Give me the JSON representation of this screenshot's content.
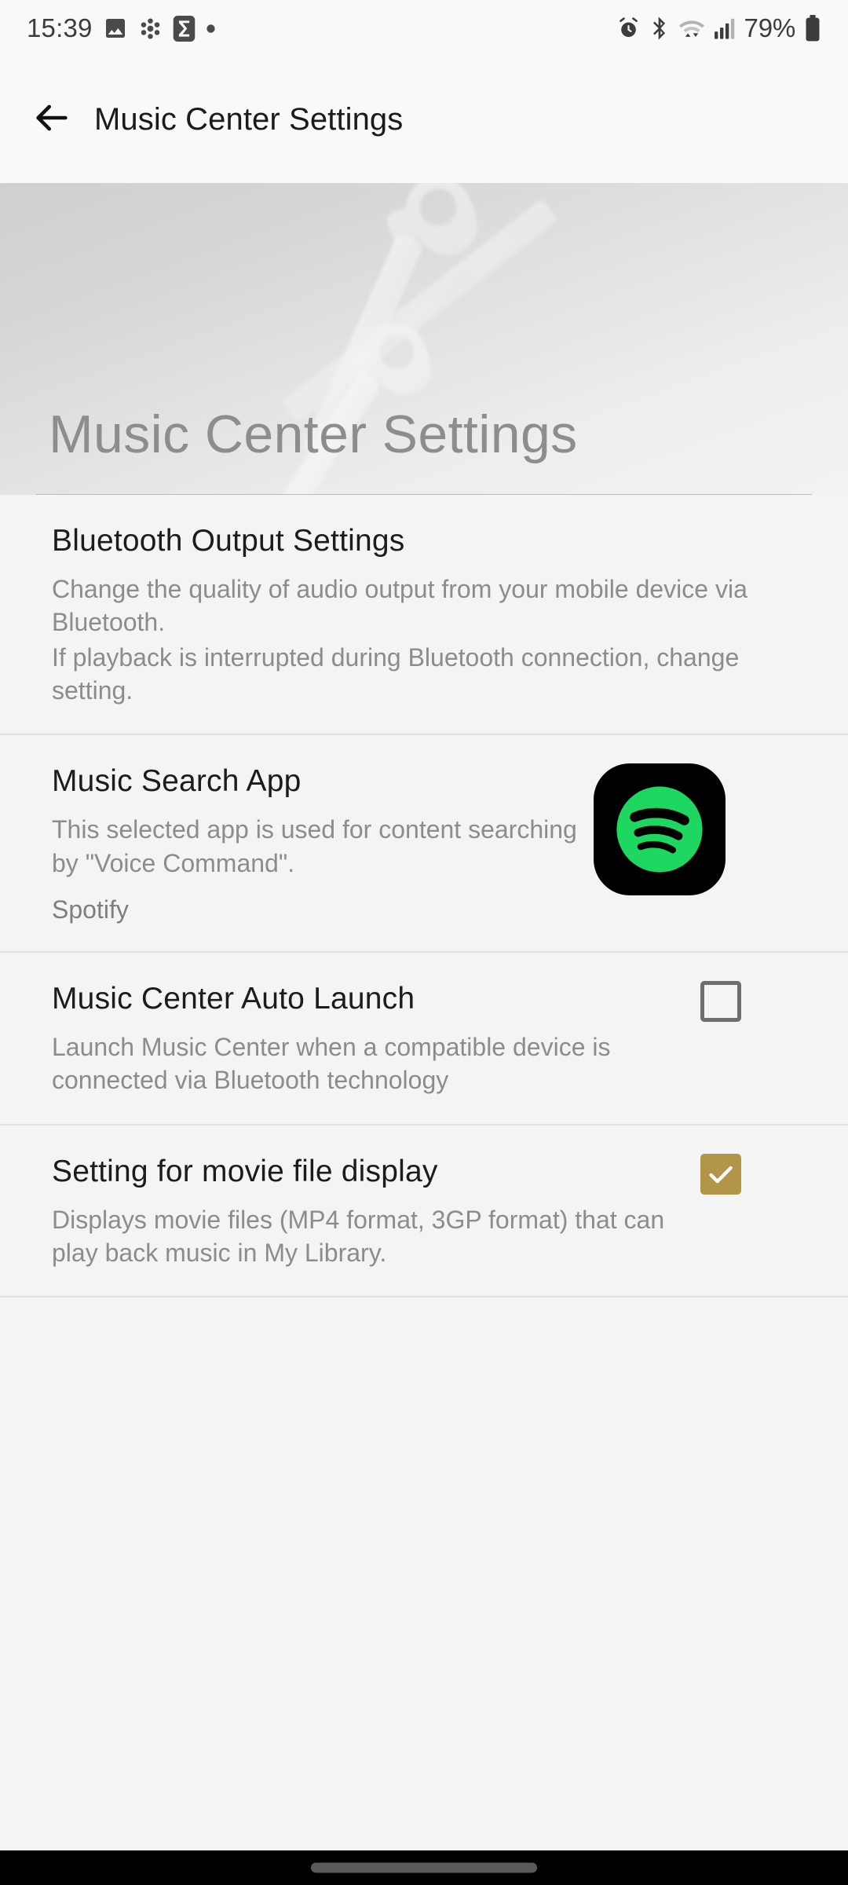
{
  "statusbar": {
    "time": "15:39",
    "battery_percent": "79%",
    "left_icons": [
      "image-icon",
      "snowflake-icon",
      "sigma-icon",
      "dot-icon"
    ],
    "right_icons": [
      "alarm-icon",
      "bluetooth-icon",
      "wifi-icon",
      "cellular-signal-icon",
      "battery-icon"
    ]
  },
  "appbar": {
    "back_icon": "back-arrow-icon",
    "title": "Music Center Settings"
  },
  "hero": {
    "title": "Music Center Settings",
    "artwork": "wrench-tools-watermark"
  },
  "settings": [
    {
      "id": "bluetooth-output-settings",
      "title": "Bluetooth Output Settings",
      "desc_lines": [
        "Change the quality of audio output from your mobile device via Bluetooth.",
        "If playback is interrupted during Bluetooth connection, change setting."
      ]
    },
    {
      "id": "music-search-app",
      "title": "Music Search App",
      "desc_lines": [
        "This selected app is used for content searching by \"Voice Command\"."
      ],
      "value": "Spotify",
      "accessory": "spotify-app-icon"
    },
    {
      "id": "music-center-auto-launch",
      "title": "Music Center Auto Launch",
      "desc_lines": [
        "Launch Music Center when a compatible device is connected via Bluetooth technology"
      ],
      "accessory": "checkbox",
      "checked": false
    },
    {
      "id": "setting-for-movie-file-display",
      "title": "Setting for movie file display",
      "desc_lines": [
        "Displays movie files (MP4 format, 3GP format) that can play back music in My Library."
      ],
      "accessory": "checkbox",
      "checked": true
    }
  ],
  "colors": {
    "page_background": "#f4f4f4",
    "appbar_background": "#f9f9f9",
    "title_text": "#1c1c1c",
    "secondary_text": "#8c8c8c",
    "checkbox_checked": "#b3954a",
    "checkbox_unchecked": "#6e6e6e",
    "spotify_green": "#1ed760",
    "divider": "#e1e1e1"
  },
  "navbar": {
    "gesture_pill": "home-gesture-pill"
  }
}
